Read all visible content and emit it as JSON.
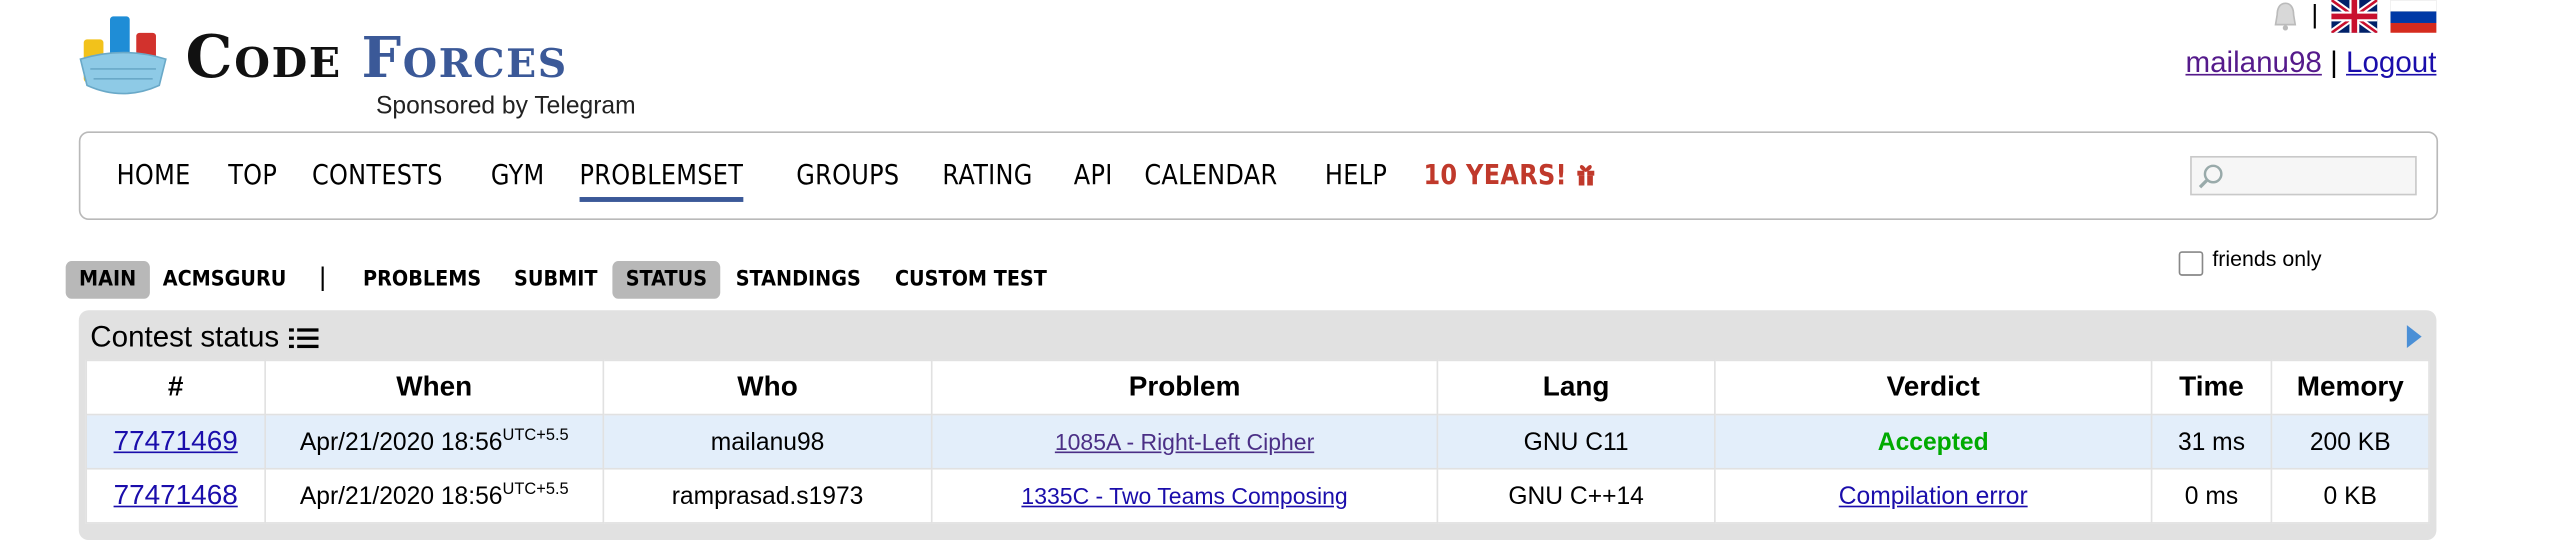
{
  "header": {
    "logo_code": "Code",
    "logo_forces": "Forces",
    "sponsor": "Sponsored by Telegram",
    "username": "mailanu98",
    "separator": "|",
    "logout": "Logout"
  },
  "nav": {
    "items": [
      "HOME",
      "TOP",
      "CONTESTS",
      "GYM",
      "PROBLEMSET",
      "GROUPS",
      "RATING",
      "API",
      "CALENDAR",
      "HELP"
    ],
    "active": "PROBLEMSET",
    "ten_years": "10 YEARS!"
  },
  "submenu": {
    "items": [
      "MAIN",
      "ACMSGURU",
      "PROBLEMS",
      "SUBMIT",
      "STATUS",
      "STANDINGS",
      "CUSTOM TEST"
    ],
    "active": [
      "MAIN",
      "STATUS"
    ]
  },
  "friends_only": "friends only",
  "status": {
    "title": "Contest status",
    "columns": [
      "#",
      "When",
      "Who",
      "Problem",
      "Lang",
      "Verdict",
      "Time",
      "Memory"
    ],
    "rows": [
      {
        "id": "77471469",
        "when": "Apr/21/2020 18:56",
        "tz": "UTC+5.5",
        "who": "mailanu98",
        "problem": "1085A - Right-Left Cipher",
        "lang": "GNU C11",
        "verdict": "Accepted",
        "time": "31 ms",
        "memory": "200 KB"
      },
      {
        "id": "77471468",
        "when": "Apr/21/2020 18:56",
        "tz": "UTC+5.5",
        "who": "ramprasad.s1973",
        "problem": "1335C - Two Teams Composing",
        "lang": "GNU C++14",
        "verdict": "Compilation error",
        "time": "0 ms",
        "memory": "0 KB"
      }
    ]
  },
  "colors": {
    "accent": "#3b5998",
    "accepted": "#00aa00",
    "ten_years": "#c0392b",
    "link": "#1a0dab"
  }
}
